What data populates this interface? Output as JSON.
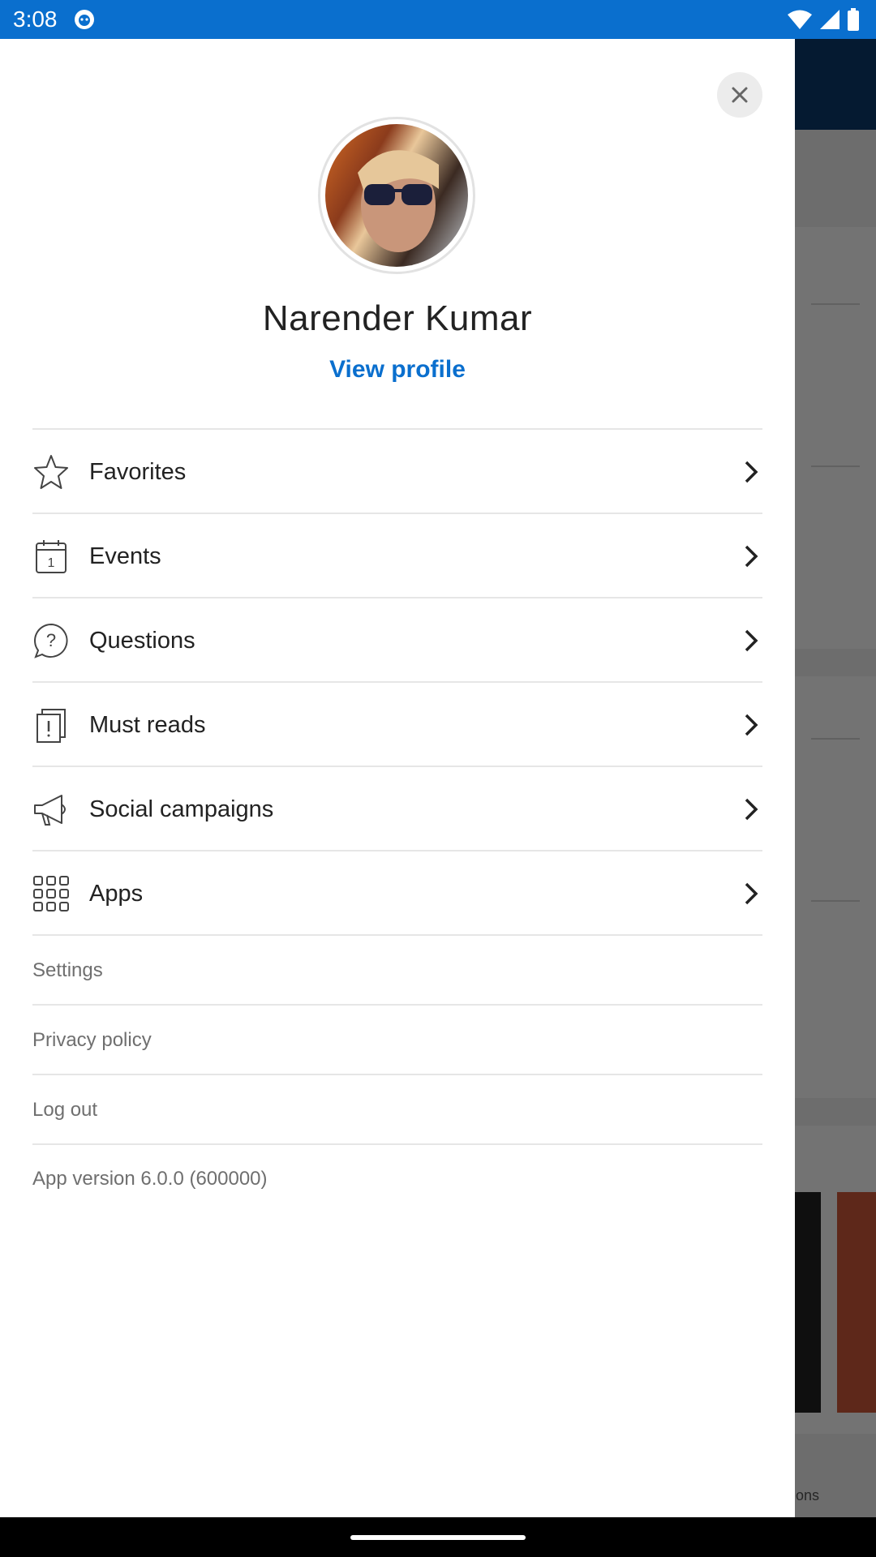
{
  "status_bar": {
    "time": "3:08",
    "left_icon": "app-notification-icon",
    "right_icons": [
      "wifi-icon",
      "cell-signal-icon",
      "battery-icon"
    ]
  },
  "background_app": {
    "bottom_partial_text": "tions"
  },
  "drawer": {
    "close_icon": "close-icon",
    "user": {
      "name": "Narender Kumar",
      "view_profile": "View profile"
    },
    "menu": [
      {
        "label": "Favorites",
        "icon": "star-icon"
      },
      {
        "label": "Events",
        "icon": "calendar-icon"
      },
      {
        "label": "Questions",
        "icon": "question-bubble-icon"
      },
      {
        "label": "Must reads",
        "icon": "must-read-icon"
      },
      {
        "label": "Social campaigns",
        "icon": "megaphone-icon"
      },
      {
        "label": "Apps",
        "icon": "apps-grid-icon"
      }
    ],
    "links": [
      {
        "label": "Settings"
      },
      {
        "label": "Privacy policy"
      },
      {
        "label": "Log out"
      }
    ],
    "app_version": "App version 6.0.0 (600000)"
  },
  "colors": {
    "accent": "#0a6fce",
    "status_bar": "#0a6fce",
    "header_dark": "#0d3b6e"
  }
}
